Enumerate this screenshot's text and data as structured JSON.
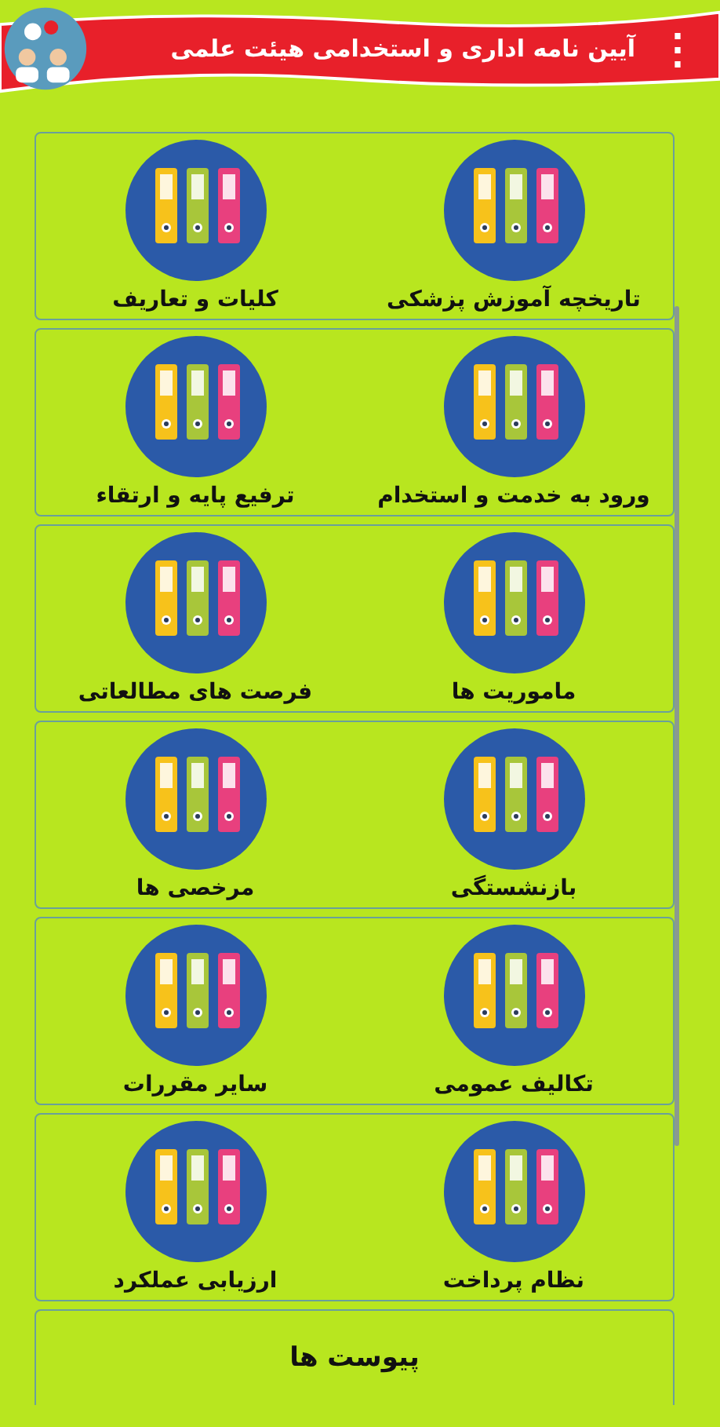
{
  "header": {
    "title": "آیین نامه اداری و استخدامی هیئت علمی",
    "menu_icon": "⋮"
  },
  "rows": [
    {
      "items": [
        "تاریخچه آموزش پزشکی",
        "کلیات و تعاریف"
      ]
    },
    {
      "items": [
        "ورود به خدمت و استخدام",
        "ترفیع پایه و ارتقاء"
      ]
    },
    {
      "items": [
        "ماموریت ها",
        "فرصت های مطالعاتی"
      ]
    },
    {
      "items": [
        "بازنشستگی",
        "مرخصی ها"
      ]
    },
    {
      "items": [
        "تکالیف عمومی",
        "سایر مقررات"
      ]
    },
    {
      "items": [
        "نظام پرداخت",
        "ارزیابی عملکرد"
      ]
    }
  ],
  "footer_item": "پیوست ها"
}
